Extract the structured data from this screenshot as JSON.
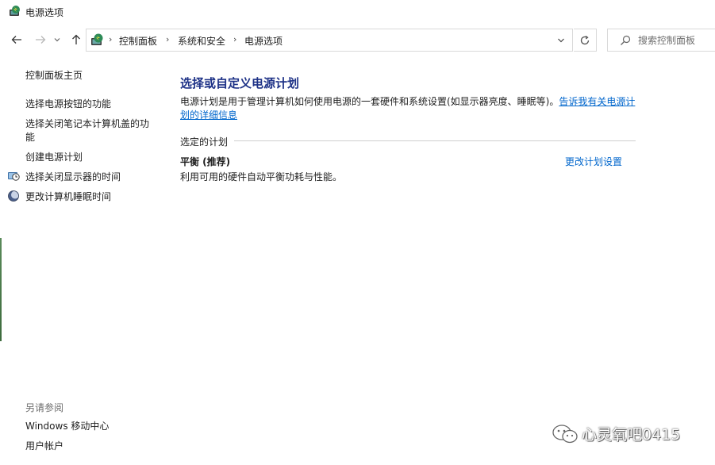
{
  "window": {
    "title": "电源选项",
    "icon": "power-options-icon"
  },
  "navigation": {
    "back_icon": "back-arrow-icon",
    "forward_icon": "forward-arrow-icon",
    "recent_icon": "chevron-down-icon",
    "up_icon": "up-arrow-icon",
    "breadcrumb": [
      "控制面板",
      "系统和安全",
      "电源选项"
    ],
    "dropdown_icon": "chevron-down-icon",
    "refresh_icon": "refresh-icon",
    "search_placeholder": "搜索控制面板"
  },
  "sidebar": {
    "home": "控制面板主页",
    "items": [
      {
        "label": "选择电源按钮的功能",
        "icon": null
      },
      {
        "label": "选择关闭笔记本计算机盖的功能",
        "icon": null
      },
      {
        "label": "创建电源计划",
        "icon": null
      },
      {
        "label": "选择关闭显示器的时间",
        "icon": "monitor-clock-icon"
      },
      {
        "label": "更改计算机睡眠时间",
        "icon": "moon-icon"
      }
    ],
    "see_also_heading": "另请参阅",
    "see_also": [
      "Windows 移动中心",
      "用户帐户"
    ]
  },
  "main": {
    "title": "选择或自定义电源计划",
    "description": "电源计划是用于管理计算机如何使用电源的一套硬件和系统设置(如显示器亮度、睡眠等)。",
    "description_link": "告诉我有关电源计划的详细信息",
    "section_heading": "选定的计划",
    "plan": {
      "name": "平衡 (推荐)",
      "description": "利用可用的硬件自动平衡功耗与性能。",
      "change_link": "更改计划设置"
    }
  },
  "watermark": {
    "text": "心灵氧吧0415",
    "icon": "wechat-icon"
  },
  "colors": {
    "title_blue": "#1e3287",
    "link_blue": "#0066cc",
    "border_gray": "#d9d9d9"
  }
}
